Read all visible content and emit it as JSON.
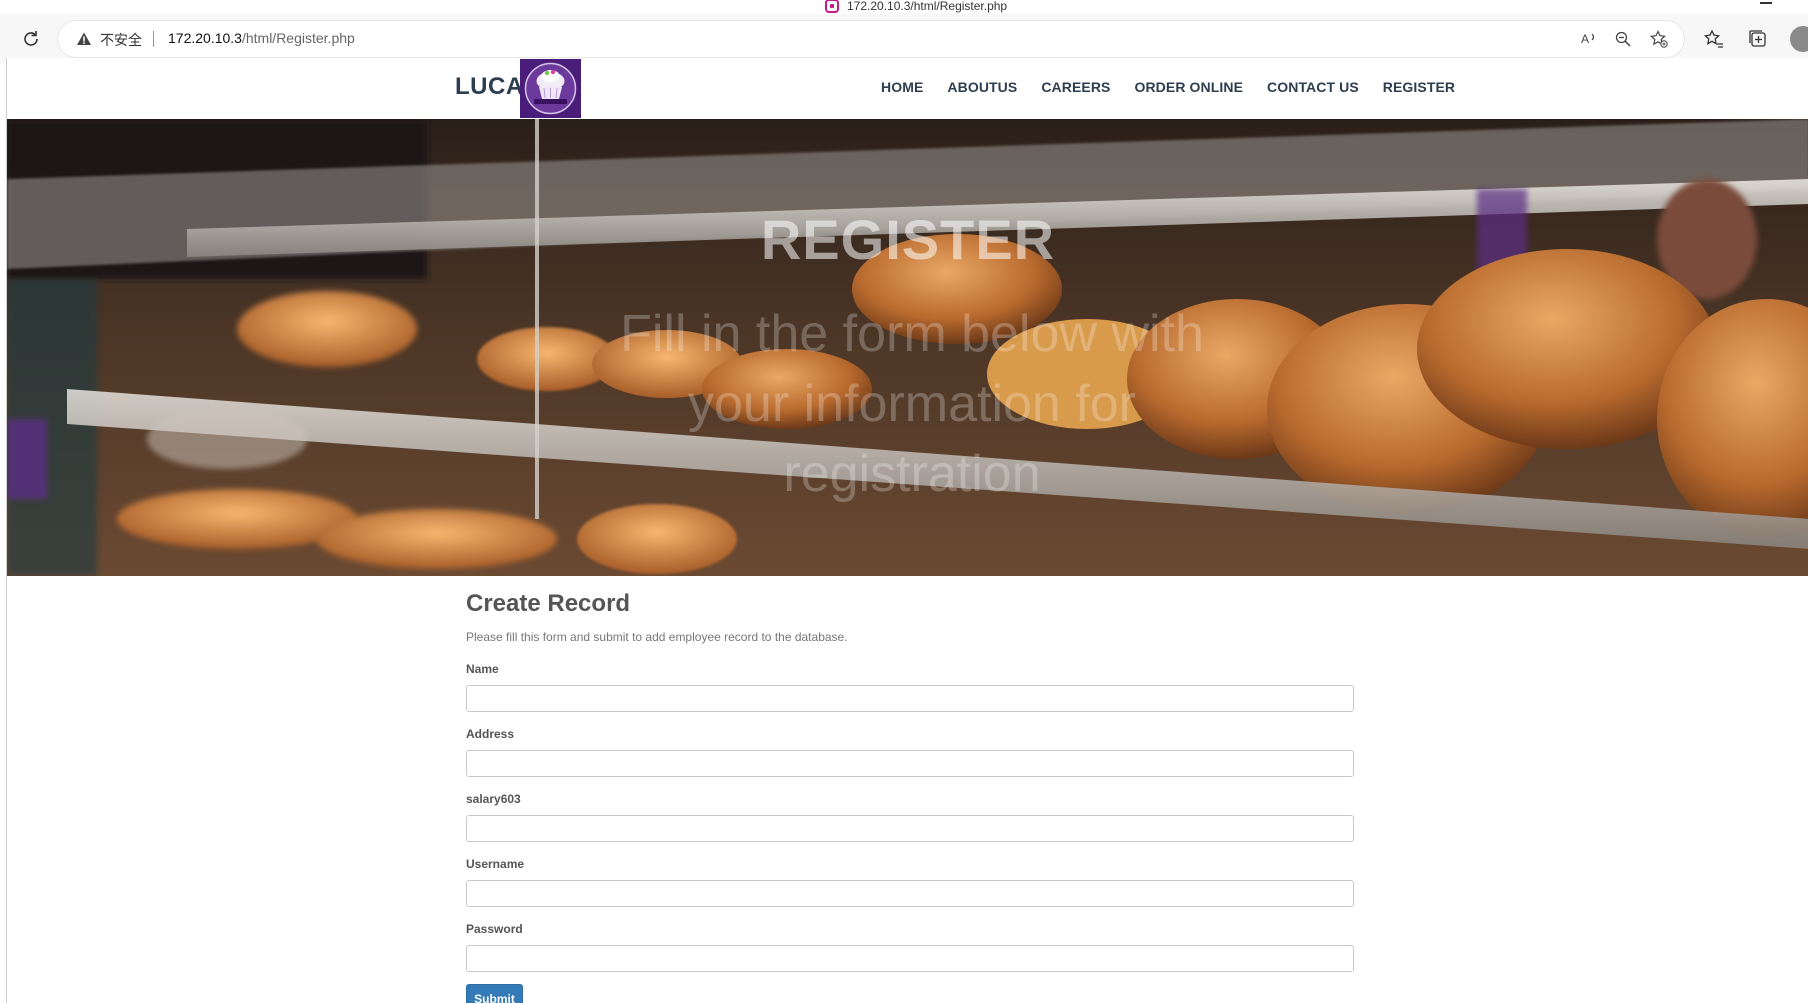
{
  "browser": {
    "window_title": "172.20.10.3/html/Register.php",
    "insecure_label": "不安全",
    "url_host": "172.20.10.3",
    "url_path": "/html/Register.php"
  },
  "nav": {
    "brand": "LUCA",
    "links": [
      "HOME",
      "ABOUTUS",
      "CAREERS",
      "ORDER ONLINE",
      "CONTACT US",
      "REGISTER"
    ]
  },
  "hero": {
    "title": "REGISTER",
    "subtitle": "Fill in the form below with your information for registration"
  },
  "form": {
    "title": "Create Record",
    "description": "Please fill this form and submit to add employee record to the database.",
    "fields": [
      {
        "label": "Name",
        "value": ""
      },
      {
        "label": "Address",
        "value": ""
      },
      {
        "label": "salary603",
        "value": ""
      },
      {
        "label": "Username",
        "value": ""
      },
      {
        "label": "Password",
        "value": ""
      }
    ],
    "submit_label": "Submit"
  },
  "colors": {
    "nav_text": "#2c3e50",
    "logo_bg": "#4a1d7a",
    "submit_bg": "#337ab7",
    "address_bar_bg": "#f7f7f7"
  }
}
